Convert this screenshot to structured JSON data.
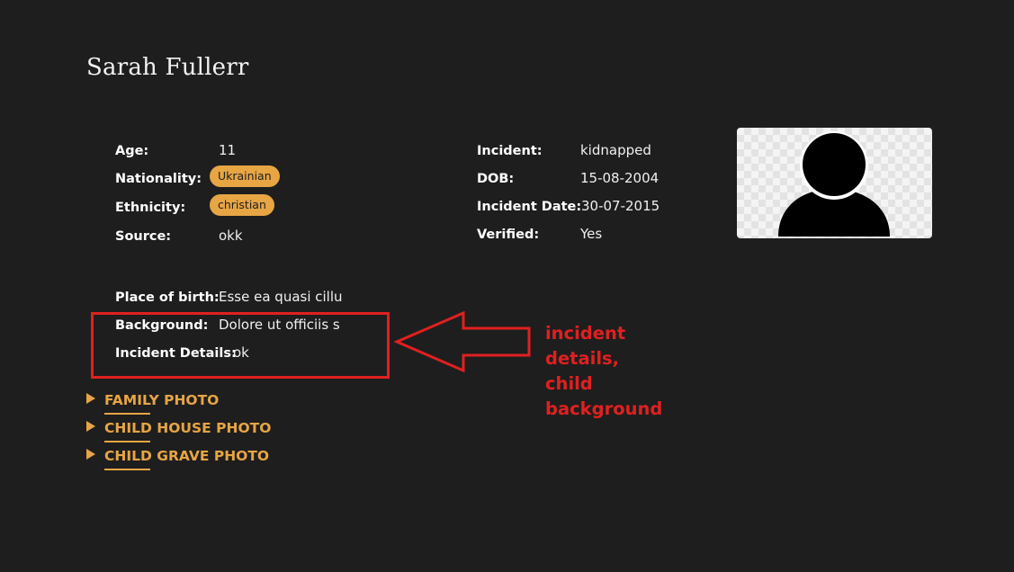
{
  "profile": {
    "name": "Sarah Fullerr"
  },
  "left_fields": {
    "age_label": "Age:",
    "age_value": "11",
    "nationality_label": "Nationality:",
    "nationality_value": "Ukrainian",
    "ethnicity_label": "Ethnicity:",
    "ethnicity_value": "christian",
    "source_label": "Source:",
    "source_value": "okk"
  },
  "right_fields": {
    "incident_label": "Incident:",
    "incident_value": "kidnapped",
    "dob_label": "DOB:",
    "dob_value": "15-08-2004",
    "incident_date_label": "Incident Date:",
    "incident_date_value": "30-07-2015",
    "verified_label": "Verified:",
    "verified_value": "Yes"
  },
  "details": {
    "place_of_birth_label": "Place of birth:",
    "place_of_birth_value": "Esse ea quasi cillu",
    "background_label": "Background:",
    "background_value": "Dolore ut officiis s",
    "incident_details_label": "Incident Details:",
    "incident_details_value": "ok"
  },
  "sections": [
    {
      "label": "FAMILY PHOTO"
    },
    {
      "label": "CHILD HOUSE PHOTO"
    },
    {
      "label": "CHILD GRAVE PHOTO"
    }
  ],
  "annotation": {
    "text": "incident details, child background",
    "color": "#e02020"
  },
  "colors": {
    "background": "#1e1e1e",
    "accent": "#e7a544",
    "text": "#ffffff"
  },
  "icons": {
    "avatar": "user-silhouette-icon",
    "disclosure": "triangle-right-icon"
  }
}
